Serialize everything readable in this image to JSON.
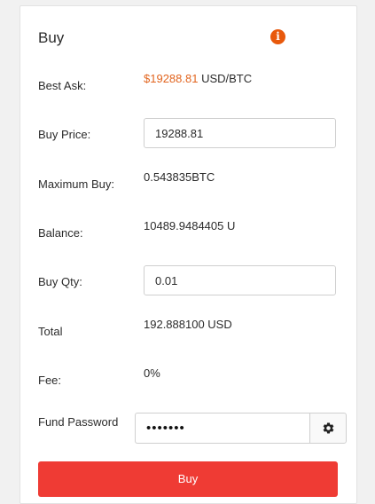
{
  "panel": {
    "title": "Buy",
    "info_icon": "info-icon",
    "info_glyph": "i"
  },
  "best_ask": {
    "label": "Best Ask:",
    "price": "$19288.81",
    "unit": " USD/BTC",
    "accent_color": "#e2651f"
  },
  "buy_price": {
    "label": "Buy Price:",
    "value": "19288.81"
  },
  "max_buy": {
    "label": "Maximum Buy:",
    "value": "0.543835BTC"
  },
  "balance": {
    "label": "Balance:",
    "value": "10489.9484405 U"
  },
  "buy_qty": {
    "label": "Buy Qty:",
    "value": "0.01"
  },
  "total": {
    "label": "Total",
    "value": "192.888100 USD"
  },
  "fee": {
    "label": "Fee:",
    "value": "0%"
  },
  "fund_password": {
    "label": "Fund Password",
    "value": "•••••••",
    "settings_icon": "gear-icon"
  },
  "buy_button": {
    "label": "Buy",
    "color": "#ef3b34"
  }
}
